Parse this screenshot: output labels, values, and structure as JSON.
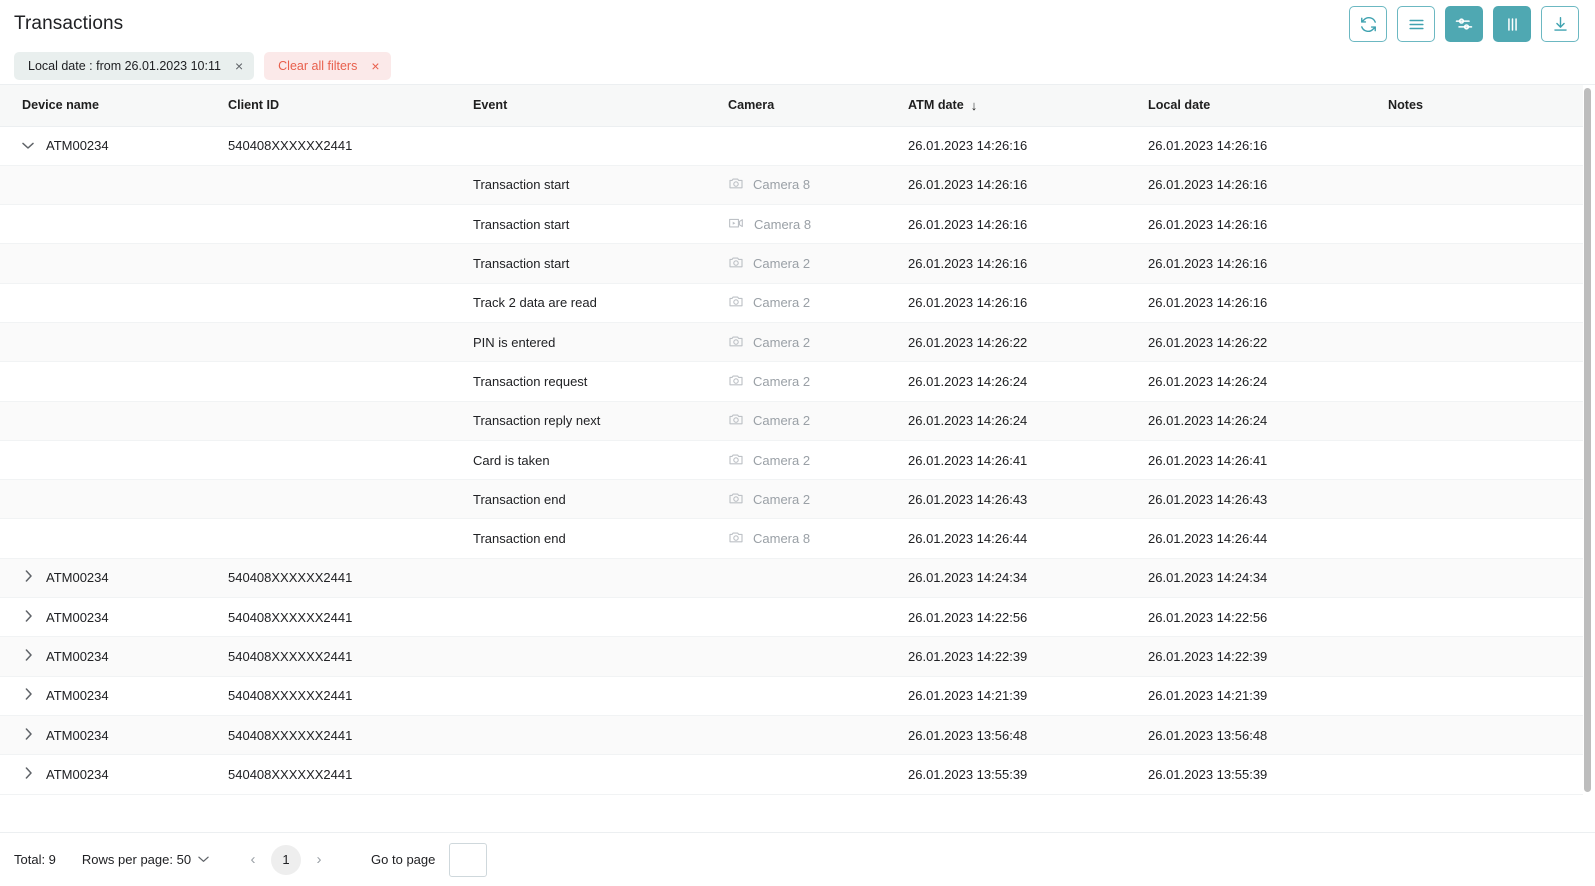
{
  "header": {
    "title": "Transactions",
    "toolbar": [
      {
        "name": "refresh-button",
        "icon": "refresh-icon",
        "active": false
      },
      {
        "name": "list-view-button",
        "icon": "list-icon",
        "active": false
      },
      {
        "name": "filter-settings-button",
        "icon": "sliders-icon",
        "active": true
      },
      {
        "name": "columns-button",
        "icon": "columns-icon",
        "active": true
      },
      {
        "name": "download-button",
        "icon": "download-icon",
        "active": false
      }
    ]
  },
  "filters": {
    "chips": [
      {
        "label": "Local date : from 26.01.2023 10:11",
        "style": "neutral",
        "close": "×"
      },
      {
        "label": "Clear all filters",
        "style": "danger",
        "close": "×"
      }
    ]
  },
  "table": {
    "columns": [
      {
        "key": "device",
        "label": "Device name",
        "sorted": false
      },
      {
        "key": "client",
        "label": "Client ID",
        "sorted": false
      },
      {
        "key": "event",
        "label": "Event",
        "sorted": false
      },
      {
        "key": "camera",
        "label": "Camera",
        "sorted": false
      },
      {
        "key": "atm_date",
        "label": "ATM date",
        "sorted": true,
        "sort_arrow": "↓"
      },
      {
        "key": "local_date",
        "label": "Local date",
        "sorted": false
      },
      {
        "key": "notes",
        "label": "Notes",
        "sorted": false
      }
    ],
    "rows": [
      {
        "type": "group",
        "expanded": true,
        "chevron": "chevron-down-icon",
        "device": "ATM00234",
        "client": "540408XXXXXX2441",
        "event": "",
        "camera": "",
        "camera_icon": "",
        "atm_date": "26.01.2023 14:26:16",
        "local_date": "26.01.2023 14:26:16",
        "notes": "",
        "zebra": false
      },
      {
        "type": "child",
        "device": "",
        "client": "",
        "event": "Transaction start",
        "camera": "Camera 8",
        "camera_icon": "photo-camera-icon",
        "atm_date": "26.01.2023 14:26:16",
        "local_date": "26.01.2023 14:26:16",
        "notes": "",
        "zebra": true
      },
      {
        "type": "child",
        "device": "",
        "client": "",
        "event": "Transaction start",
        "camera": "Camera 8",
        "camera_icon": "video-camera-icon",
        "atm_date": "26.01.2023 14:26:16",
        "local_date": "26.01.2023 14:26:16",
        "notes": "",
        "zebra": false
      },
      {
        "type": "child",
        "device": "",
        "client": "",
        "event": "Transaction start",
        "camera": "Camera 2",
        "camera_icon": "photo-camera-icon",
        "atm_date": "26.01.2023 14:26:16",
        "local_date": "26.01.2023 14:26:16",
        "notes": "",
        "zebra": true
      },
      {
        "type": "child",
        "device": "",
        "client": "",
        "event": "Track 2 data are read",
        "camera": "Camera 2",
        "camera_icon": "photo-camera-icon",
        "atm_date": "26.01.2023 14:26:16",
        "local_date": "26.01.2023 14:26:16",
        "notes": "",
        "zebra": false
      },
      {
        "type": "child",
        "device": "",
        "client": "",
        "event": "PIN is entered",
        "camera": "Camera 2",
        "camera_icon": "photo-camera-icon",
        "atm_date": "26.01.2023 14:26:22",
        "local_date": "26.01.2023 14:26:22",
        "notes": "",
        "zebra": true
      },
      {
        "type": "child",
        "device": "",
        "client": "",
        "event": "Transaction request",
        "camera": "Camera 2",
        "camera_icon": "photo-camera-icon",
        "atm_date": "26.01.2023 14:26:24",
        "local_date": "26.01.2023 14:26:24",
        "notes": "",
        "zebra": false
      },
      {
        "type": "child",
        "device": "",
        "client": "",
        "event": "Transaction reply next",
        "camera": "Camera 2",
        "camera_icon": "photo-camera-icon",
        "atm_date": "26.01.2023 14:26:24",
        "local_date": "26.01.2023 14:26:24",
        "notes": "",
        "zebra": true
      },
      {
        "type": "child",
        "device": "",
        "client": "",
        "event": "Card is taken",
        "camera": "Camera 2",
        "camera_icon": "photo-camera-icon",
        "atm_date": "26.01.2023 14:26:41",
        "local_date": "26.01.2023 14:26:41",
        "notes": "",
        "zebra": false
      },
      {
        "type": "child",
        "device": "",
        "client": "",
        "event": "Transaction end",
        "camera": "Camera 2",
        "camera_icon": "photo-camera-icon",
        "atm_date": "26.01.2023 14:26:43",
        "local_date": "26.01.2023 14:26:43",
        "notes": "",
        "zebra": true
      },
      {
        "type": "child",
        "device": "",
        "client": "",
        "event": "Transaction end",
        "camera": "Camera 8",
        "camera_icon": "photo-camera-icon",
        "atm_date": "26.01.2023 14:26:44",
        "local_date": "26.01.2023 14:26:44",
        "notes": "",
        "zebra": false
      },
      {
        "type": "group",
        "expanded": false,
        "chevron": "chevron-right-icon",
        "device": "ATM00234",
        "client": "540408XXXXXX2441",
        "event": "",
        "camera": "",
        "camera_icon": "",
        "atm_date": "26.01.2023 14:24:34",
        "local_date": "26.01.2023 14:24:34",
        "notes": "",
        "zebra": true
      },
      {
        "type": "group",
        "expanded": false,
        "chevron": "chevron-right-icon",
        "device": "ATM00234",
        "client": "540408XXXXXX2441",
        "event": "",
        "camera": "",
        "camera_icon": "",
        "atm_date": "26.01.2023 14:22:56",
        "local_date": "26.01.2023 14:22:56",
        "notes": "",
        "zebra": false
      },
      {
        "type": "group",
        "expanded": false,
        "chevron": "chevron-right-icon",
        "device": "ATM00234",
        "client": "540408XXXXXX2441",
        "event": "",
        "camera": "",
        "camera_icon": "",
        "atm_date": "26.01.2023 14:22:39",
        "local_date": "26.01.2023 14:22:39",
        "notes": "",
        "zebra": true
      },
      {
        "type": "group",
        "expanded": false,
        "chevron": "chevron-right-icon",
        "device": "ATM00234",
        "client": "540408XXXXXX2441",
        "event": "",
        "camera": "",
        "camera_icon": "",
        "atm_date": "26.01.2023 14:21:39",
        "local_date": "26.01.2023 14:21:39",
        "notes": "",
        "zebra": false
      },
      {
        "type": "group",
        "expanded": false,
        "chevron": "chevron-right-icon",
        "device": "ATM00234",
        "client": "540408XXXXXX2441",
        "event": "",
        "camera": "",
        "camera_icon": "",
        "atm_date": "26.01.2023 13:56:48",
        "local_date": "26.01.2023 13:56:48",
        "notes": "",
        "zebra": true
      },
      {
        "type": "group",
        "expanded": false,
        "chevron": "chevron-right-icon",
        "device": "ATM00234",
        "client": "540408XXXXXX2441",
        "event": "",
        "camera": "",
        "camera_icon": "",
        "atm_date": "26.01.2023 13:55:39",
        "local_date": "26.01.2023 13:55:39",
        "notes": "",
        "zebra": false
      }
    ]
  },
  "footer": {
    "total_label": "Total: 9",
    "rows_per_page_label": "Rows per page: 50",
    "rows_per_page_caret": "⌄",
    "prev_arrow": "‹",
    "next_arrow": "›",
    "current_page": "1",
    "goto_label": "Go to page",
    "goto_value": "",
    "goto_placeholder": ""
  },
  "colors": {
    "accent": "#4fa8b2",
    "accent_outline": "#6cb8c2",
    "chip_neutral_bg": "#e9efee",
    "chip_danger_bg": "#fbe9e9",
    "chip_danger_text": "#e8604d",
    "header_row_bg": "#f7f8f8",
    "zebra_bg": "#fafafa",
    "muted_text": "#9aa0a6"
  }
}
